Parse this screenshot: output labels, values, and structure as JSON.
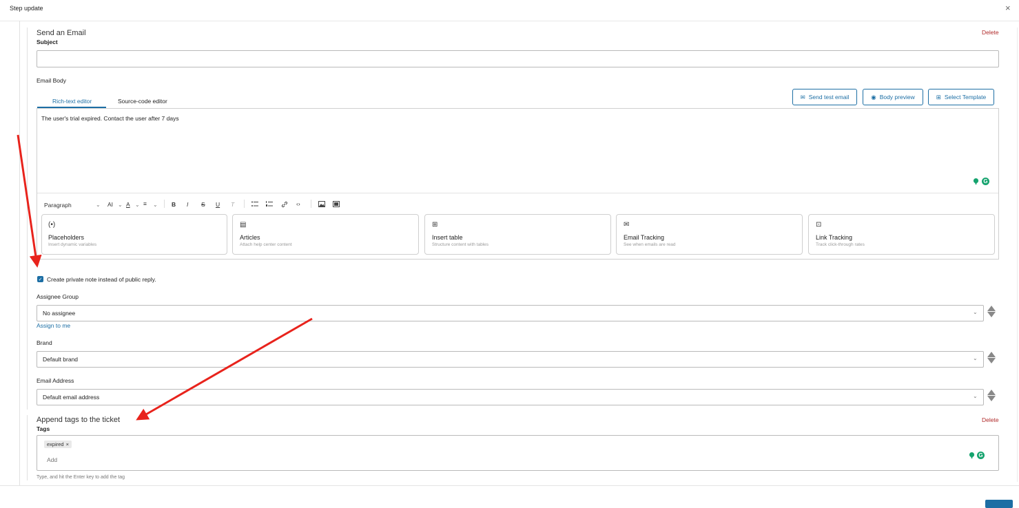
{
  "window": {
    "title": "Step update",
    "close_label": "×"
  },
  "email_step": {
    "title": "Send an Email",
    "delete_label": "Delete",
    "subject_label": "Subject",
    "subject_value": "",
    "body_label": "Email Body",
    "tabs": [
      {
        "label": "Rich-text editor",
        "active": true
      },
      {
        "label": "Source-code editor",
        "active": false
      }
    ],
    "buttons": {
      "send_test": "Send test email",
      "preview": "Body preview",
      "template": "Select Template"
    },
    "body_text": "The user's trial expired. Contact the user after 7 days",
    "toolbar": {
      "paragraph": "Paragraph",
      "font_size": "AI",
      "font_color": "A",
      "align": "≡",
      "bold": "B",
      "italic": "I",
      "strike": "S",
      "underline": "U",
      "clear": "T"
    },
    "cards": [
      {
        "icon": "(•)",
        "title": "Placeholders",
        "subtitle": "Insert dynamic variables"
      },
      {
        "icon": "▤",
        "title": "Articles",
        "subtitle": "Attach help center content"
      },
      {
        "icon": "⊞",
        "title": "Insert table",
        "subtitle": "Structure content with tables"
      },
      {
        "icon": "✉",
        "title": "Email Tracking",
        "subtitle": "See when emails are read"
      },
      {
        "icon": "⊡",
        "title": "Link Tracking",
        "subtitle": "Track click-through rates"
      }
    ],
    "private_note_label": "Create private note instead of public reply.",
    "private_note_checked": true,
    "assignee_group_label": "Assignee Group",
    "assignee_group_value": "No assignee",
    "assign_to_me": "Assign to me",
    "brand_label": "Brand",
    "brand_value": "Default brand",
    "email_address_label": "Email Address",
    "email_address_value": "Default email address"
  },
  "tags_step": {
    "title": "Append tags to the ticket",
    "delete_label": "Delete",
    "tags_label": "Tags",
    "tags": [
      {
        "label": "expired",
        "remove": "×"
      }
    ],
    "add_placeholder": "Add",
    "hint": "Type, and hit the Enter key to add the tag"
  },
  "colors": {
    "accent": "#1c6ea4",
    "delete": "#b02a2a",
    "annotation_arrow": "#e8231c"
  }
}
